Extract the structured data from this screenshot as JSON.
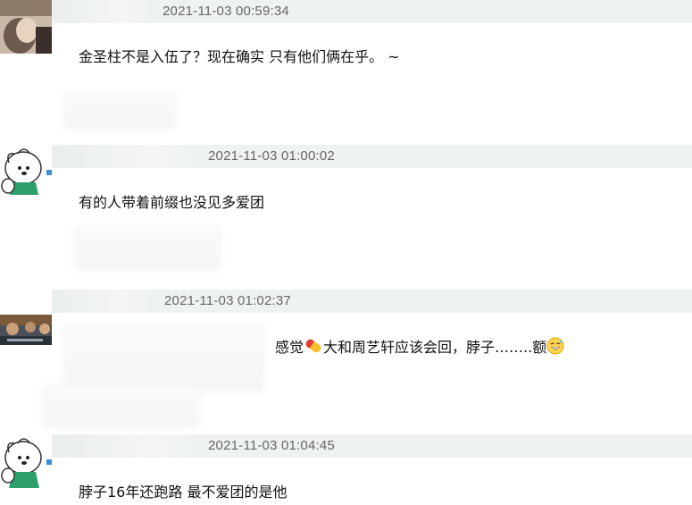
{
  "comments": [
    {
      "timestamp": "2021-11-03 00:59:34",
      "text": "金圣柱不是入伍了？现在确实 只有他们俩在乎。 ~"
    },
    {
      "timestamp": "2021-11-03 01:00:02",
      "text": "有的人带着前缀也没见多爱团"
    },
    {
      "timestamp": "2021-11-03 01:02:37",
      "text_before": "感觉",
      "emoji_pill": "pill-emoji",
      "text_after": "大和周艺轩应该会回，脖子……..额",
      "emoji_face": "sweat-smile-emoji"
    },
    {
      "timestamp": "2021-11-03 01:04:45",
      "text": "脖子16年还跑路 最不爱团的是他"
    }
  ],
  "colors": {
    "header_bg": "#eef2f1",
    "timestamp": "#666666",
    "text": "#111111"
  }
}
